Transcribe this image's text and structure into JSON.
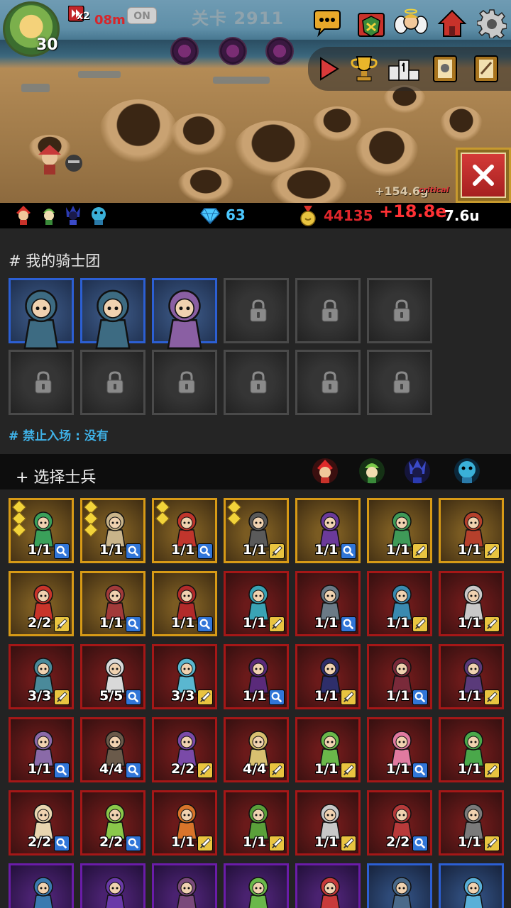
{
  "hud": {
    "player_level": "30",
    "speed_multiplier": "x2",
    "speed_timer": "08m",
    "auto_toggle": "ON",
    "stage_title": "关卡 2911",
    "float_gold": "+154.6g",
    "float_critical": "critical"
  },
  "resources": {
    "gems": "63",
    "gold": "44135",
    "income": "+18.8e",
    "income_rate": "7.6u"
  },
  "knights": {
    "title": "# 我的骑士团",
    "ban_text": "# 禁止入场 : 没有",
    "slots": [
      {
        "state": "filled",
        "color": "#3d6b82"
      },
      {
        "state": "filled",
        "color": "#3d6b82"
      },
      {
        "state": "filled",
        "color": "#8a5fa3"
      },
      {
        "state": "locked"
      },
      {
        "state": "locked"
      },
      {
        "state": "locked"
      },
      {
        "state": "locked"
      },
      {
        "state": "locked"
      },
      {
        "state": "locked"
      },
      {
        "state": "locked"
      },
      {
        "state": "locked"
      },
      {
        "state": "locked"
      }
    ]
  },
  "select": {
    "title": "+ 选择士兵",
    "filters": [
      "fire-filter-icon",
      "nature-filter-icon",
      "dark-filter-icon",
      "water-filter-icon"
    ]
  },
  "units": [
    {
      "count": "1/1",
      "frame": "gold",
      "stars": 3,
      "badge": "magnify",
      "color": "#3aa05a"
    },
    {
      "count": "1/1",
      "frame": "gold",
      "stars": 3,
      "badge": "magnify",
      "color": "#c9b48a"
    },
    {
      "count": "1/1",
      "frame": "gold",
      "stars": 2,
      "badge": "magnify",
      "color": "#c0352c"
    },
    {
      "count": "1/1",
      "frame": "gold",
      "stars": 2,
      "badge": "sword",
      "color": "#5a5a5a"
    },
    {
      "count": "1/1",
      "frame": "gold",
      "stars": 0,
      "badge": "magnify",
      "color": "#6b3a9a"
    },
    {
      "count": "1/1",
      "frame": "gold",
      "stars": 0,
      "badge": "sword",
      "color": "#3f9a58"
    },
    {
      "count": "1/1",
      "frame": "gold",
      "stars": 0,
      "badge": "sword",
      "color": "#b5402c"
    },
    {
      "count": "2/2",
      "frame": "gold",
      "stars": 0,
      "badge": "sword",
      "color": "#c8342a"
    },
    {
      "count": "1/1",
      "frame": "gold",
      "stars": 0,
      "badge": "magnify",
      "color": "#a23a3a"
    },
    {
      "count": "1/1",
      "frame": "gold",
      "stars": 0,
      "badge": "magnify",
      "color": "#b22a2a"
    },
    {
      "count": "1/1",
      "frame": "red",
      "stars": 0,
      "badge": "sword",
      "color": "#3aa3b5"
    },
    {
      "count": "1/1",
      "frame": "red",
      "stars": 0,
      "badge": "magnify",
      "color": "#6b7a86"
    },
    {
      "count": "1/1",
      "frame": "red",
      "stars": 0,
      "badge": "sword",
      "color": "#3a8ab0"
    },
    {
      "count": "1/1",
      "frame": "red",
      "stars": 0,
      "badge": "sword",
      "color": "#c9c9c9"
    },
    {
      "count": "3/3",
      "frame": "red",
      "stars": 0,
      "badge": "sword",
      "color": "#4a8a9a"
    },
    {
      "count": "5/5",
      "frame": "red",
      "stars": 0,
      "badge": "magnify",
      "color": "#d9d9d9"
    },
    {
      "count": "3/3",
      "frame": "red",
      "stars": 0,
      "badge": "sword",
      "color": "#5ab7d0"
    },
    {
      "count": "1/1",
      "frame": "red",
      "stars": 0,
      "badge": "magnify",
      "color": "#5a2a7a"
    },
    {
      "count": "1/1",
      "frame": "red",
      "stars": 0,
      "badge": "sword",
      "color": "#2e2e6a"
    },
    {
      "count": "1/1",
      "frame": "red",
      "stars": 0,
      "badge": "magnify",
      "color": "#7a2a3a"
    },
    {
      "count": "1/1",
      "frame": "red",
      "stars": 0,
      "badge": "sword",
      "color": "#5a3a7a"
    },
    {
      "count": "1/1",
      "frame": "red",
      "stars": 0,
      "badge": "magnify",
      "color": "#8a6aa8"
    },
    {
      "count": "4/4",
      "frame": "red",
      "stars": 0,
      "badge": "magnify",
      "color": "#6a5a4a"
    },
    {
      "count": "2/2",
      "frame": "red",
      "stars": 0,
      "badge": "sword",
      "color": "#7a4aa8"
    },
    {
      "count": "4/4",
      "frame": "red",
      "stars": 0,
      "badge": "sword",
      "color": "#d8c070"
    },
    {
      "count": "1/1",
      "frame": "red",
      "stars": 0,
      "badge": "sword",
      "color": "#6ab84a"
    },
    {
      "count": "1/1",
      "frame": "red",
      "stars": 0,
      "badge": "magnify",
      "color": "#e07aa0"
    },
    {
      "count": "1/1",
      "frame": "red",
      "stars": 0,
      "badge": "sword",
      "color": "#4aa84a"
    },
    {
      "count": "2/2",
      "frame": "red",
      "stars": 0,
      "badge": "magnify",
      "color": "#e8d6b0"
    },
    {
      "count": "2/2",
      "frame": "red",
      "stars": 0,
      "badge": "magnify",
      "color": "#8ac84a"
    },
    {
      "count": "1/1",
      "frame": "red",
      "stars": 0,
      "badge": "sword",
      "color": "#d8742a"
    },
    {
      "count": "1/1",
      "frame": "red",
      "stars": 0,
      "badge": "sword",
      "color": "#5aa03a"
    },
    {
      "count": "1/1",
      "frame": "red",
      "stars": 0,
      "badge": "sword",
      "color": "#c8c8c8"
    },
    {
      "count": "2/2",
      "frame": "red",
      "stars": 0,
      "badge": "magnify",
      "color": "#b83a3a"
    },
    {
      "count": "1/1",
      "frame": "red",
      "stars": 0,
      "badge": "sword",
      "color": "#7a7a7a"
    },
    {
      "count": "",
      "frame": "purple",
      "stars": 0,
      "badge": "",
      "color": "#3a7ab0"
    },
    {
      "count": "",
      "frame": "purple",
      "stars": 0,
      "badge": "",
      "color": "#6a3aa8"
    },
    {
      "count": "",
      "frame": "purple",
      "stars": 0,
      "badge": "",
      "color": "#7a4a7a"
    },
    {
      "count": "",
      "frame": "purple",
      "stars": 0,
      "badge": "",
      "color": "#6ab84a"
    },
    {
      "count": "",
      "frame": "purple",
      "stars": 0,
      "badge": "",
      "color": "#c83a3a"
    },
    {
      "count": "",
      "frame": "blue",
      "stars": 0,
      "badge": "",
      "color": "#4a6a8a"
    },
    {
      "count": "",
      "frame": "blue",
      "stars": 0,
      "badge": "",
      "color": "#5ab0d8"
    }
  ]
}
